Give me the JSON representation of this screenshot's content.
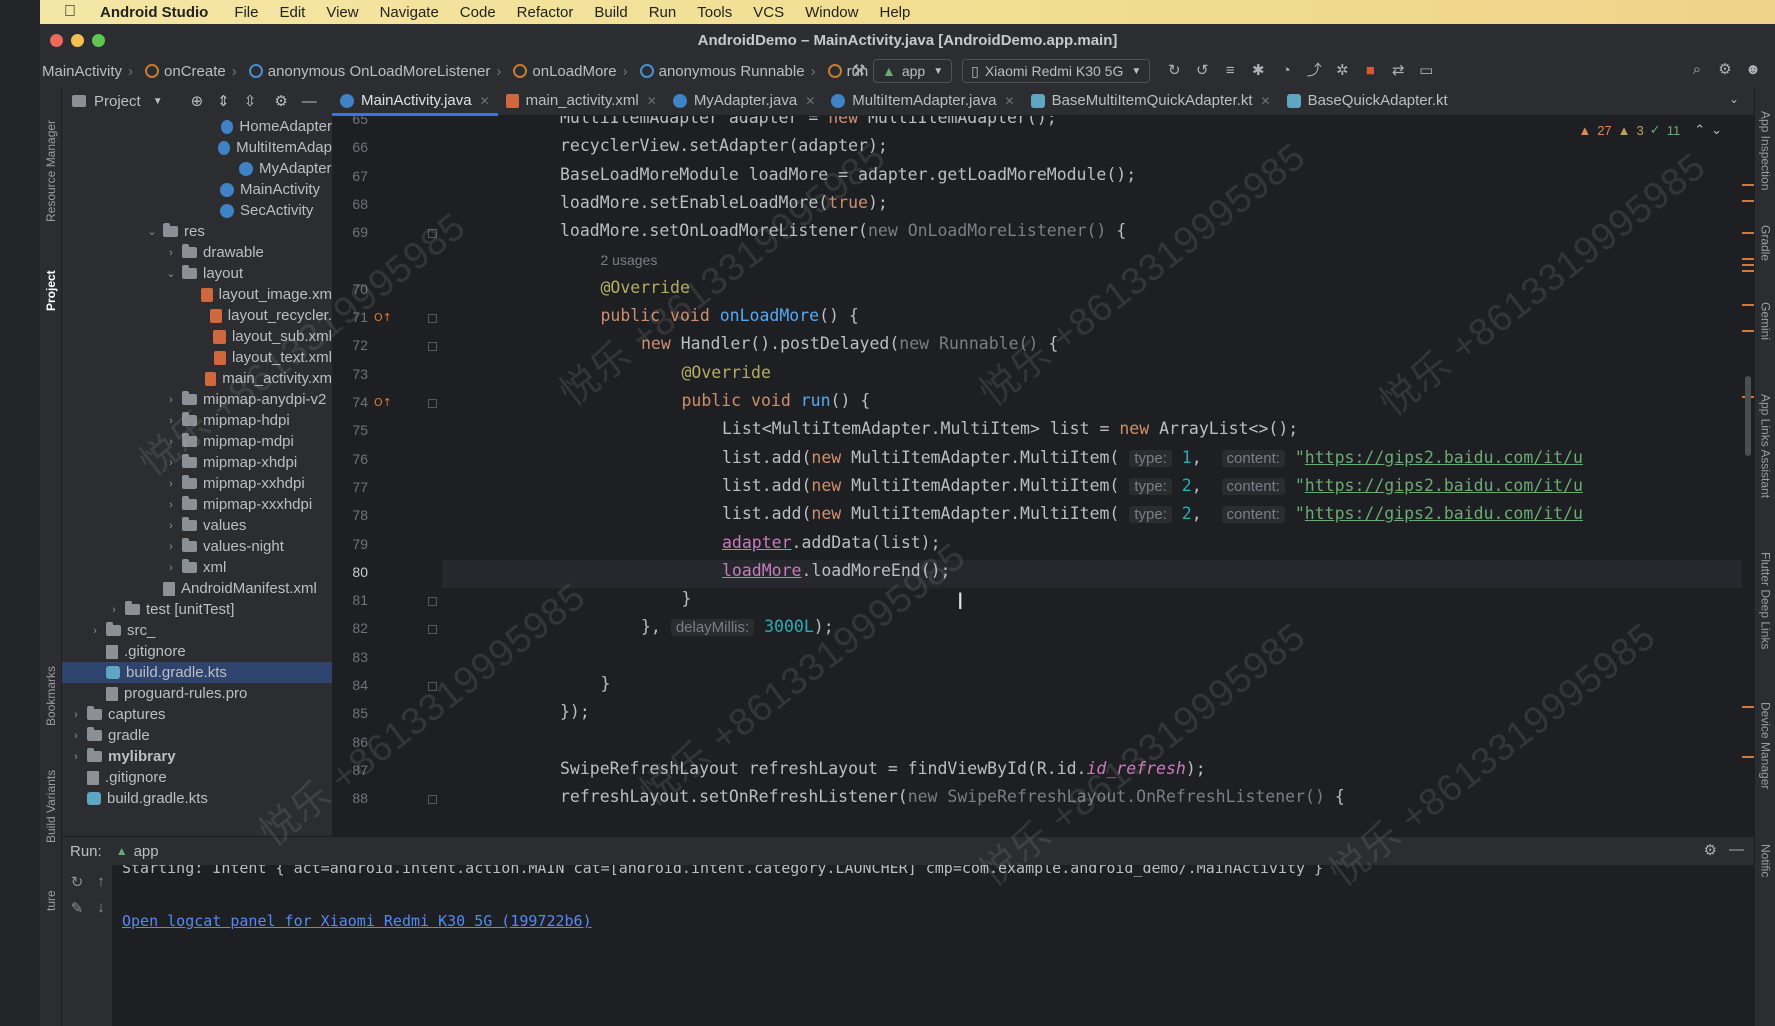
{
  "menubar": {
    "app": "Android Studio",
    "items": [
      "File",
      "Edit",
      "View",
      "Navigate",
      "Code",
      "Refactor",
      "Build",
      "Run",
      "Tools",
      "VCS",
      "Window",
      "Help"
    ]
  },
  "window": {
    "title": "AndroidDemo – MainActivity.java [AndroidDemo.app.main]"
  },
  "breadcrumbs": [
    "MainActivity",
    "onCreate",
    "anonymous OnLoadMoreListener",
    "onLoadMore",
    "anonymous Runnable",
    "run"
  ],
  "toolbar": {
    "run_config": "app",
    "device": "Xiaomi Redmi K30 5G"
  },
  "left_strip": {
    "resource_manager": "Resource Manager",
    "project": "Project",
    "bookmarks": "Bookmarks",
    "build_variants": "Build Variants",
    "structure": "ture"
  },
  "right_strip": {
    "app_inspection": "App Inspection",
    "gradle": "Gradle",
    "gemini": "Gemini",
    "app_links": "App Links Assistant",
    "flutter": "Flutter Deep Links",
    "device_manager": "Device Manager",
    "notifications": "Notific"
  },
  "project_panel": {
    "title": "Project",
    "rows": [
      {
        "label": "HomeAdapter",
        "indent": 9,
        "icon": "class"
      },
      {
        "label": "MultiItemAdap",
        "indent": 9,
        "icon": "class"
      },
      {
        "label": "MyAdapter",
        "indent": 9,
        "icon": "class"
      },
      {
        "label": "MainActivity",
        "indent": 8,
        "icon": "class"
      },
      {
        "label": "SecActivity",
        "indent": 8,
        "icon": "class"
      },
      {
        "label": "res",
        "indent": 5,
        "icon": "folder",
        "twisty": "open"
      },
      {
        "label": "drawable",
        "indent": 6,
        "icon": "folder",
        "twisty": "closed"
      },
      {
        "label": "layout",
        "indent": 6,
        "icon": "folder",
        "twisty": "open"
      },
      {
        "label": "layout_image.xm",
        "indent": 8,
        "icon": "xml"
      },
      {
        "label": "layout_recycler.",
        "indent": 8,
        "icon": "xml"
      },
      {
        "label": "layout_sub.xml",
        "indent": 8,
        "icon": "xml"
      },
      {
        "label": "layout_text.xml",
        "indent": 8,
        "icon": "xml"
      },
      {
        "label": "main_activity.xm",
        "indent": 8,
        "icon": "xml"
      },
      {
        "label": "mipmap-anydpi-v2",
        "indent": 6,
        "icon": "folder",
        "twisty": "closed"
      },
      {
        "label": "mipmap-hdpi",
        "indent": 6,
        "icon": "folder",
        "twisty": "closed"
      },
      {
        "label": "mipmap-mdpi",
        "indent": 6,
        "icon": "folder",
        "twisty": "closed"
      },
      {
        "label": "mipmap-xhdpi",
        "indent": 6,
        "icon": "folder",
        "twisty": "closed"
      },
      {
        "label": "mipmap-xxhdpi",
        "indent": 6,
        "icon": "folder",
        "twisty": "closed"
      },
      {
        "label": "mipmap-xxxhdpi",
        "indent": 6,
        "icon": "folder",
        "twisty": "closed"
      },
      {
        "label": "values",
        "indent": 6,
        "icon": "folder",
        "twisty": "closed"
      },
      {
        "label": "values-night",
        "indent": 6,
        "icon": "folder",
        "twisty": "closed"
      },
      {
        "label": "xml",
        "indent": 6,
        "icon": "folder",
        "twisty": "closed"
      },
      {
        "label": "AndroidManifest.xml",
        "indent": 5,
        "icon": "file"
      },
      {
        "label": "test [unitTest]",
        "indent": 3,
        "icon": "folder",
        "twisty": "closed"
      },
      {
        "label": "src_",
        "indent": 2,
        "icon": "folder",
        "twisty": "closed"
      },
      {
        "label": ".gitignore",
        "indent": 2,
        "icon": "file"
      },
      {
        "label": "build.gradle.kts",
        "indent": 2,
        "icon": "gradle",
        "selected": true
      },
      {
        "label": "proguard-rules.pro",
        "indent": 2,
        "icon": "file"
      },
      {
        "label": "captures",
        "indent": 1,
        "icon": "folder",
        "twisty": "closed"
      },
      {
        "label": "gradle",
        "indent": 1,
        "icon": "folder",
        "twisty": "closed"
      },
      {
        "label": "mylibrary",
        "indent": 1,
        "icon": "folder",
        "twisty": "closed",
        "bold": true
      },
      {
        "label": ".gitignore",
        "indent": 1,
        "icon": "file"
      },
      {
        "label": "build.gradle.kts",
        "indent": 1,
        "icon": "gradle"
      }
    ]
  },
  "tabs": [
    {
      "label": "MainActivity.java",
      "icon": "class",
      "active": true
    },
    {
      "label": "main_activity.xml",
      "icon": "xml"
    },
    {
      "label": "MyAdapter.java",
      "icon": "class"
    },
    {
      "label": "MultiItemAdapter.java",
      "icon": "class"
    },
    {
      "label": "BaseMultiItemQuickAdapter.kt",
      "icon": "kt"
    },
    {
      "label": "BaseQuickAdapter.kt",
      "icon": "kt"
    }
  ],
  "inspection": {
    "warnings": "27",
    "weak": "3",
    "ok": "11"
  },
  "editor": {
    "current_line": "80",
    "lines": [
      {
        "n": "65",
        "indent": 0,
        "parts": [
          [
            "",
            "MultiItemAdapter adapter = "
          ],
          [
            "kw",
            "new "
          ],
          [
            "",
            "MultiItemAdapter();"
          ]
        ]
      },
      {
        "n": "66",
        "indent": 0,
        "parts": [
          [
            "",
            "recyclerView.setAdapter(adapter);"
          ]
        ]
      },
      {
        "n": "67",
        "indent": 0,
        "parts": [
          [
            "",
            "BaseLoadMoreModule loadMore = adapter.getLoadMoreModule();"
          ]
        ]
      },
      {
        "n": "68",
        "indent": 0,
        "parts": [
          [
            "",
            "loadMore.setEnableLoadMore("
          ],
          [
            "kw",
            "true"
          ],
          [
            "",
            ");"
          ]
        ]
      },
      {
        "n": "69",
        "indent": 0,
        "parts": [
          [
            "",
            "loadMore.setOnLoadMoreListener("
          ],
          [
            "gray",
            "new OnLoadMoreListener() "
          ],
          [
            "",
            "{"
          ]
        ]
      },
      {
        "n": "",
        "indent": 1,
        "parts": [
          [
            "usages",
            "2 usages"
          ]
        ]
      },
      {
        "n": "70",
        "indent": 1,
        "parts": [
          [
            "an",
            "@Override"
          ]
        ]
      },
      {
        "n": "71",
        "indent": 1,
        "parts": [
          [
            "kw",
            "public void "
          ],
          [
            "fn",
            "onLoadMore"
          ],
          [
            "",
            "() {"
          ]
        ]
      },
      {
        "n": "72",
        "indent": 2,
        "parts": [
          [
            "kw",
            "new "
          ],
          [
            "",
            "Handler().postDelayed("
          ],
          [
            "gray",
            "new Runnable() "
          ],
          [
            "",
            "{"
          ]
        ]
      },
      {
        "n": "73",
        "indent": 3,
        "parts": [
          [
            "an",
            "@Override"
          ]
        ]
      },
      {
        "n": "74",
        "indent": 3,
        "parts": [
          [
            "kw",
            "public void "
          ],
          [
            "fn",
            "run"
          ],
          [
            "",
            "() {"
          ]
        ]
      },
      {
        "n": "75",
        "indent": 4,
        "parts": [
          [
            "",
            "List<MultiItemAdapter.MultiItem> list = "
          ],
          [
            "kw",
            "new "
          ],
          [
            "",
            "ArrayList<>();"
          ]
        ]
      },
      {
        "n": "76",
        "indent": 4,
        "parts": [
          [
            "",
            "list.add("
          ],
          [
            "kw",
            "new "
          ],
          [
            "",
            "MultiItemAdapter.MultiItem( "
          ],
          [
            "hint",
            "type:"
          ],
          [
            "num",
            " 1"
          ],
          [
            "",
            ",  "
          ],
          [
            "hint",
            "content:"
          ],
          [
            "str",
            " \""
          ],
          [
            "url",
            "https://gips2.baidu.com/it/u"
          ]
        ]
      },
      {
        "n": "77",
        "indent": 4,
        "parts": [
          [
            "",
            "list.add("
          ],
          [
            "kw",
            "new "
          ],
          [
            "",
            "MultiItemAdapter.MultiItem( "
          ],
          [
            "hint",
            "type:"
          ],
          [
            "num",
            " 2"
          ],
          [
            "",
            ",  "
          ],
          [
            "hint",
            "content:"
          ],
          [
            "str",
            " \""
          ],
          [
            "url",
            "https://gips2.baidu.com/it/u"
          ]
        ]
      },
      {
        "n": "78",
        "indent": 4,
        "parts": [
          [
            "",
            "list.add("
          ],
          [
            "kw",
            "new "
          ],
          [
            "",
            "MultiItemAdapter.MultiItem( "
          ],
          [
            "hint",
            "type:"
          ],
          [
            "num",
            " 2"
          ],
          [
            "",
            ",  "
          ],
          [
            "hint",
            "content:"
          ],
          [
            "str",
            " \""
          ],
          [
            "url",
            "https://gips2.baidu.com/it/u"
          ]
        ]
      },
      {
        "n": "79",
        "indent": 4,
        "parts": [
          [
            "fieldref",
            "adapter"
          ],
          [
            "",
            ".addData(list);"
          ]
        ]
      },
      {
        "n": "80",
        "indent": 4,
        "parts": [
          [
            "fieldref",
            "loadMore"
          ],
          [
            "",
            ".loadMoreEnd();"
          ]
        ]
      },
      {
        "n": "81",
        "indent": 3,
        "parts": [
          [
            "",
            "}"
          ]
        ]
      },
      {
        "n": "82",
        "indent": 2,
        "parts": [
          [
            "",
            "}, "
          ],
          [
            "hint",
            "delayMillis:"
          ],
          [
            "num",
            " 3000L"
          ],
          [
            "",
            ");"
          ]
        ]
      },
      {
        "n": "83",
        "indent": 0,
        "parts": [
          [
            "",
            ""
          ]
        ]
      },
      {
        "n": "84",
        "indent": 1,
        "parts": [
          [
            "",
            "}"
          ]
        ]
      },
      {
        "n": "85",
        "indent": 0,
        "parts": [
          [
            "",
            "});"
          ]
        ]
      },
      {
        "n": "86",
        "indent": 0,
        "parts": [
          [
            "",
            ""
          ]
        ]
      },
      {
        "n": "87",
        "indent": 0,
        "parts": [
          [
            "",
            "SwipeRefreshLayout refreshLayout = findViewById(R.id."
          ],
          [
            "italic",
            "id_refresh"
          ],
          [
            "",
            ");"
          ]
        ]
      },
      {
        "n": "88",
        "indent": 0,
        "parts": [
          [
            "",
            "refreshLayout.setOnRefreshListener("
          ],
          [
            "gray",
            "new SwipeRefreshLayout.OnRefreshListener() "
          ],
          [
            "",
            "{"
          ]
        ]
      }
    ]
  },
  "run_panel": {
    "label": "Run:",
    "tab": "app",
    "console_line1": "Starting: Intent { act=android.intent.action.MAIN cat=[android.intent.category.LAUNCHER] cmp=com.example.android_demo/.MainActivity }",
    "console_link": "Open logcat panel for Xiaomi Redmi K30 5G (199722b6)"
  },
  "watermark": "悦乐 +8613319995985",
  "colors": {
    "editor_bg": "#1e1f22",
    "panel_bg": "#2b2d30",
    "accent": "#3574f0",
    "selection": "#2e436e"
  }
}
